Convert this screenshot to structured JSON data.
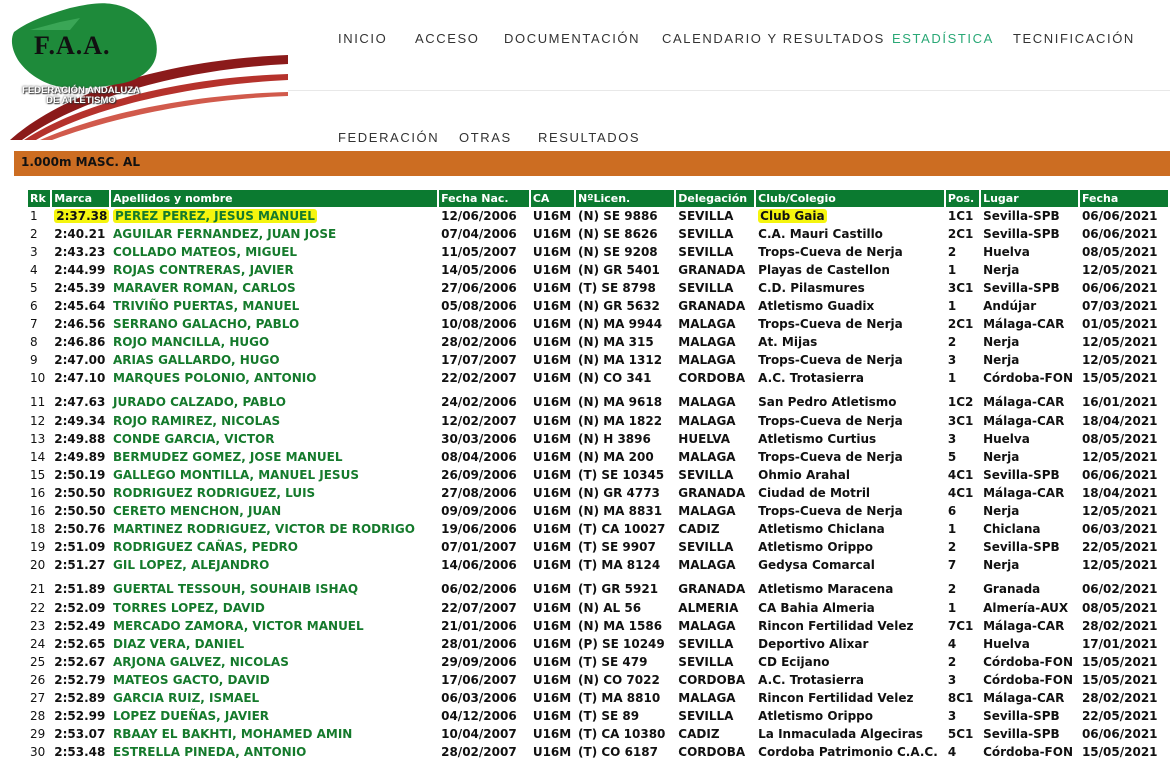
{
  "logo": {
    "name": "F.A.A.",
    "subtitle_line1": "FEDERACIÓN ANDALUZA",
    "subtitle_line2": "DE ATLETISMO"
  },
  "nav": [
    "INICIO",
    "ACCESO",
    "DOCUMENTACIÓN",
    "CALENDARIO Y RESULTADOS",
    "ESTADÍSTICA",
    "TECNIFICACIÓN"
  ],
  "nav_active": "ESTADÍSTICA",
  "subnav": [
    "FEDERACIÓN",
    "OTRAS",
    "RESULTADOS"
  ],
  "section_title": "1.000m MASC. AL",
  "colors": {
    "accent": "#2aa876",
    "header_bar": "#cc6d22",
    "table_header": "#0b7a30",
    "name_green": "#157a2c",
    "highlight": "#f5f50e"
  },
  "table": {
    "headers": [
      "Rk",
      "Marca",
      "Apellidos y nombre",
      "Fecha Nac.",
      "CA",
      "NºLicen.",
      "Delegación",
      "Club/Colegio",
      "Pos.",
      "Lugar",
      "Fecha"
    ],
    "rows": [
      [
        "1",
        "2:37.38",
        "PEREZ PEREZ, JESUS MANUEL",
        "12/06/2006",
        "U16M",
        "(N) SE 9886",
        "SEVILLA",
        "Club Gaia",
        "1C1",
        "Sevilla-SPB",
        "06/06/2021"
      ],
      [
        "2",
        "2:40.21",
        "AGUILAR FERNANDEZ, JUAN JOSE",
        "07/04/2006",
        "U16M",
        "(N) SE 8626",
        "SEVILLA",
        "C.A. Mauri Castillo",
        "2C1",
        "Sevilla-SPB",
        "06/06/2021"
      ],
      [
        "3",
        "2:43.23",
        "COLLADO MATEOS, MIGUEL",
        "11/05/2007",
        "U16M",
        "(N) SE 9208",
        "SEVILLA",
        "Trops-Cueva de Nerja",
        "2",
        "Huelva",
        "08/05/2021"
      ],
      [
        "4",
        "2:44.99",
        "ROJAS CONTRERAS, JAVIER",
        "14/05/2006",
        "U16M",
        "(N) GR 5401",
        "GRANADA",
        "Playas de Castellon",
        "1",
        "Nerja",
        "12/05/2021"
      ],
      [
        "5",
        "2:45.39",
        "MARAVER ROMAN, CARLOS",
        "27/06/2006",
        "U16M",
        "(T) SE 8798",
        "SEVILLA",
        "C.D. Pilasmures",
        "3C1",
        "Sevilla-SPB",
        "06/06/2021"
      ],
      [
        "6",
        "2:45.64",
        "TRIVIÑO PUERTAS, MANUEL",
        "05/08/2006",
        "U16M",
        "(N) GR 5632",
        "GRANADA",
        "Atletismo Guadix",
        "1",
        "Andújar",
        "07/03/2021"
      ],
      [
        "7",
        "2:46.56",
        "SERRANO GALACHO, PABLO",
        "10/08/2006",
        "U16M",
        "(N) MA 9944",
        "MALAGA",
        "Trops-Cueva de Nerja",
        "2C1",
        "Málaga-CAR",
        "01/05/2021"
      ],
      [
        "8",
        "2:46.86",
        "ROJO MANCILLA, HUGO",
        "28/02/2006",
        "U16M",
        "(N) MA 315",
        "MALAGA",
        "At. Mijas",
        "2",
        "Nerja",
        "12/05/2021"
      ],
      [
        "9",
        "2:47.00",
        "ARIAS GALLARDO, HUGO",
        "17/07/2007",
        "U16M",
        "(N) MA 1312",
        "MALAGA",
        "Trops-Cueva de Nerja",
        "3",
        "Nerja",
        "12/05/2021"
      ],
      [
        "10",
        "2:47.10",
        "MARQUES POLONIO, ANTONIO",
        "22/02/2007",
        "U16M",
        "(N) CO 341",
        "CORDOBA",
        "A.C. Trotasierra",
        "1",
        "Córdoba-FON",
        "15/05/2021"
      ],
      [
        "11",
        "2:47.63",
        "JURADO CALZADO, PABLO",
        "24/02/2006",
        "U16M",
        "(N) MA 9618",
        "MALAGA",
        "San Pedro Atletismo",
        "1C2",
        "Málaga-CAR",
        "16/01/2021"
      ],
      [
        "12",
        "2:49.34",
        "ROJO RAMIREZ, NICOLAS",
        "12/02/2007",
        "U16M",
        "(N) MA 1822",
        "MALAGA",
        "Trops-Cueva de Nerja",
        "3C1",
        "Málaga-CAR",
        "18/04/2021"
      ],
      [
        "13",
        "2:49.88",
        "CONDE GARCIA, VICTOR",
        "30/03/2006",
        "U16M",
        "(N) H 3896",
        "HUELVA",
        "Atletismo Curtius",
        "3",
        "Huelva",
        "08/05/2021"
      ],
      [
        "14",
        "2:49.89",
        "BERMUDEZ GOMEZ, JOSE MANUEL",
        "08/04/2006",
        "U16M",
        "(N) MA 200",
        "MALAGA",
        "Trops-Cueva de Nerja",
        "5",
        "Nerja",
        "12/05/2021"
      ],
      [
        "15",
        "2:50.19",
        "GALLEGO MONTILLA, MANUEL JESUS",
        "26/09/2006",
        "U16M",
        "(T) SE 10345",
        "SEVILLA",
        "Ohmio Arahal",
        "4C1",
        "Sevilla-SPB",
        "06/06/2021"
      ],
      [
        "16",
        "2:50.50",
        "RODRIGUEZ RODRIGUEZ, LUIS",
        "27/08/2006",
        "U16M",
        "(N) GR 4773",
        "GRANADA",
        "Ciudad de Motril",
        "4C1",
        "Málaga-CAR",
        "18/04/2021"
      ],
      [
        "16",
        "2:50.50",
        "CERETO MENCHON, JUAN",
        "09/09/2006",
        "U16M",
        "(N) MA 8831",
        "MALAGA",
        "Trops-Cueva de Nerja",
        "6",
        "Nerja",
        "12/05/2021"
      ],
      [
        "18",
        "2:50.76",
        "MARTINEZ RODRIGUEZ, VICTOR DE RODRIGO",
        "19/06/2006",
        "U16M",
        "(T) CA 10027",
        "CADIZ",
        "Atletismo Chiclana",
        "1",
        "Chiclana",
        "06/03/2021"
      ],
      [
        "19",
        "2:51.09",
        "RODRIGUEZ CAÑAS, PEDRO",
        "07/01/2007",
        "U16M",
        "(T) SE 9907",
        "SEVILLA",
        "Atletismo Orippo",
        "2",
        "Sevilla-SPB",
        "22/05/2021"
      ],
      [
        "20",
        "2:51.27",
        "GIL LOPEZ, ALEJANDRO",
        "14/06/2006",
        "U16M",
        "(T) MA 8124",
        "MALAGA",
        "Gedysa Comarcal",
        "7",
        "Nerja",
        "12/05/2021"
      ],
      [
        "21",
        "2:51.89",
        "GUERTAL TESSOUH, SOUHAIB ISHAQ",
        "06/02/2006",
        "U16M",
        "(T) GR 5921",
        "GRANADA",
        "Atletismo Maracena",
        "2",
        "Granada",
        "06/02/2021"
      ],
      [
        "22",
        "2:52.09",
        "TORRES LOPEZ, DAVID",
        "22/07/2007",
        "U16M",
        "(N) AL 56",
        "ALMERIA",
        "CA Bahia Almeria",
        "1",
        "Almería-AUX",
        "08/05/2021"
      ],
      [
        "23",
        "2:52.49",
        "MERCADO ZAMORA, VICTOR MANUEL",
        "21/01/2006",
        "U16M",
        "(N) MA 1586",
        "MALAGA",
        "Rincon Fertilidad Velez",
        "7C1",
        "Málaga-CAR",
        "28/02/2021"
      ],
      [
        "24",
        "2:52.65",
        "DIAZ VERA, DANIEL",
        "28/01/2006",
        "U16M",
        "(P) SE 10249",
        "SEVILLA",
        "Deportivo Alixar",
        "4",
        "Huelva",
        "17/01/2021"
      ],
      [
        "25",
        "2:52.67",
        "ARJONA GALVEZ, NICOLAS",
        "29/09/2006",
        "U16M",
        "(T) SE 479",
        "SEVILLA",
        "CD Ecijano",
        "2",
        "Córdoba-FON",
        "15/05/2021"
      ],
      [
        "26",
        "2:52.79",
        "MATEOS GACTO, DAVID",
        "17/06/2007",
        "U16M",
        "(N) CO 7022",
        "CORDOBA",
        "A.C. Trotasierra",
        "3",
        "Córdoba-FON",
        "15/05/2021"
      ],
      [
        "27",
        "2:52.89",
        "GARCIA RUIZ, ISMAEL",
        "06/03/2006",
        "U16M",
        "(T) MA 8810",
        "MALAGA",
        "Rincon Fertilidad Velez",
        "8C1",
        "Málaga-CAR",
        "28/02/2021"
      ],
      [
        "28",
        "2:52.99",
        "LOPEZ DUEÑAS, JAVIER",
        "04/12/2006",
        "U16M",
        "(T) SE 89",
        "SEVILLA",
        "Atletismo Orippo",
        "3",
        "Sevilla-SPB",
        "22/05/2021"
      ],
      [
        "29",
        "2:53.07",
        "RBAAY EL BAKHTI, MOHAMED AMIN",
        "10/04/2007",
        "U16M",
        "(T) CA 10380",
        "CADIZ",
        "La Inmaculada Algeciras",
        "5C1",
        "Sevilla-SPB",
        "06/06/2021"
      ],
      [
        "30",
        "2:53.48",
        "ESTRELLA PINEDA, ANTONIO",
        "28/02/2007",
        "U16M",
        "(T) CO 6187",
        "CORDOBA",
        "Cordoba Patrimonio C.A.C.",
        "4",
        "Córdoba-FON",
        "15/05/2021"
      ]
    ]
  }
}
